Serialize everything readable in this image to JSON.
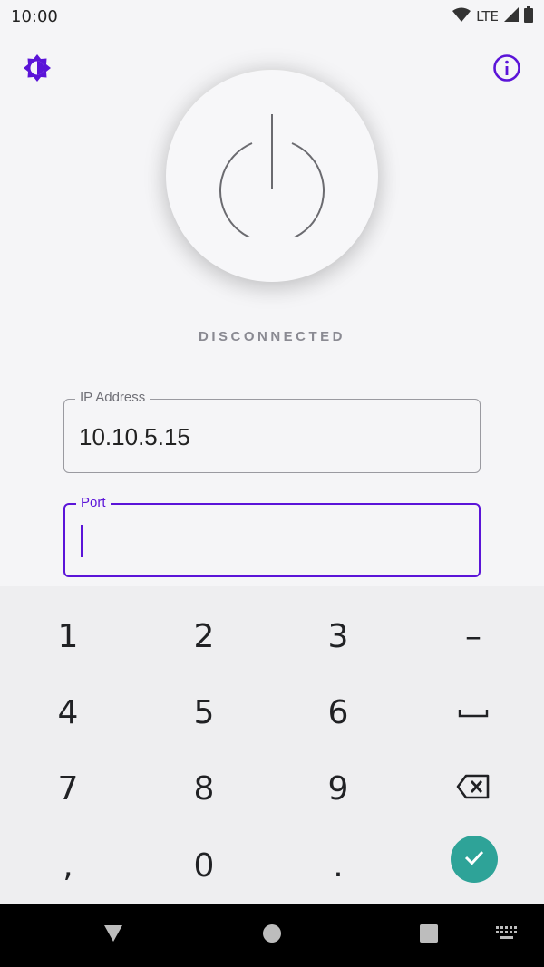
{
  "status_bar": {
    "time": "10:00",
    "network": "LTE"
  },
  "connection": {
    "status": "DISCONNECTED"
  },
  "ip_field": {
    "label": "IP Address",
    "value": "10.10.5.15"
  },
  "port_field": {
    "label": "Port",
    "value": ""
  },
  "keypad": {
    "keys": [
      "1",
      "2",
      "3",
      "–",
      "4",
      "5",
      "6",
      "␣",
      "7",
      "8",
      "9",
      "⌫",
      ",",
      "0",
      ".",
      "✓"
    ]
  },
  "colors": {
    "accent": "#5B14D8",
    "confirm": "#2EA398"
  },
  "icons": [
    "theme-icon",
    "info-icon",
    "power-icon",
    "wifi-icon",
    "signal-icon",
    "battery-icon",
    "backspace-icon",
    "check-icon",
    "back-icon",
    "home-icon",
    "recents-icon",
    "keyboard-icon"
  ]
}
